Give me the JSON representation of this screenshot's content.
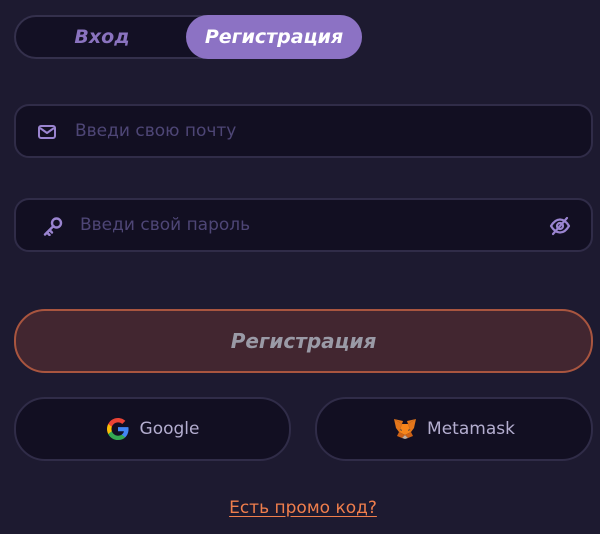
{
  "tabs": {
    "login_label": "Вход",
    "register_label": "Регистрация",
    "active": "register"
  },
  "email": {
    "placeholder": "Введи свою почту",
    "value": "",
    "icon": "envelope-icon"
  },
  "password": {
    "placeholder": "Введи свой пароль",
    "value": "",
    "icon": "key-icon",
    "toggle_icon": "eye-off-icon"
  },
  "register_button": {
    "label": "Регистрация"
  },
  "social": {
    "google_label": "Google",
    "metamask_label": "Metamask"
  },
  "promo": {
    "label": "Есть промо код?"
  },
  "colors": {
    "background": "#1d1a30",
    "accent_purple": "#8c72c4",
    "accent_orange": "#f07e4c",
    "field_border": "#302c48"
  }
}
